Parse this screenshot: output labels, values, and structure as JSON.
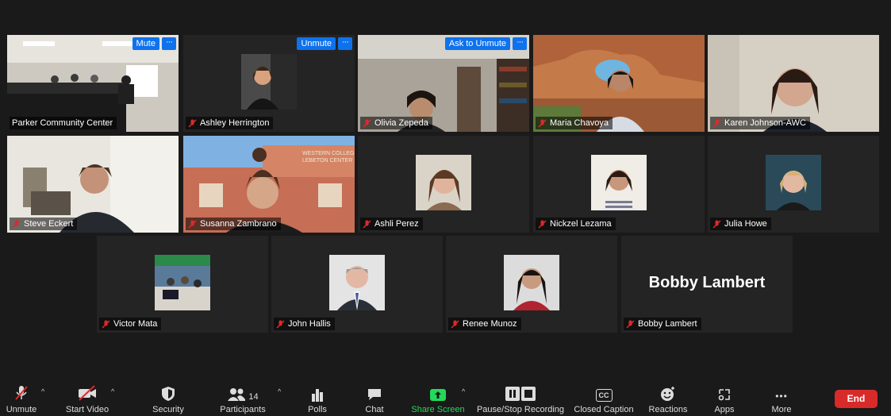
{
  "tiles": [
    {
      "name": "Parker Community Center",
      "control": "Mute"
    },
    {
      "name": "Ashley Herrington",
      "control": "Unmute"
    },
    {
      "name": "Olivia Zepeda",
      "control": "Ask to Unmute"
    },
    {
      "name": "Maria Chavoya"
    },
    {
      "name": "Karen Johnson-AWC"
    },
    {
      "name": "Steve Eckert"
    },
    {
      "name": "Susanna Zambrano",
      "background_text": "WESTERN COLLEGE\nLEBETON CENTER"
    },
    {
      "name": "Ashli Perez"
    },
    {
      "name": "Nickzel Lezama"
    },
    {
      "name": "Julia Howe"
    },
    {
      "name": "Victor Mata"
    },
    {
      "name": "John Hallis"
    },
    {
      "name": "Renee Munoz"
    },
    {
      "name": "Bobby Lambert",
      "display_name": "Bobby Lambert"
    }
  ],
  "more_dots": "···",
  "toolbar": {
    "unmute": "Unmute",
    "start_video": "Start Video",
    "security": "Security",
    "participants": "Participants",
    "participants_count": "14",
    "polls": "Polls",
    "chat": "Chat",
    "share_screen": "Share Screen",
    "pause_recording": "Pause/Stop Recording",
    "closed_caption": "Closed Caption",
    "cc_badge": "CC",
    "reactions": "Reactions",
    "apps": "Apps",
    "more": "More",
    "more_dots": "•••",
    "end": "End"
  },
  "colors": {
    "active_border": "#9fd44a",
    "control_blue": "#0e72ed",
    "share_green": "#23d959",
    "end_red": "#d92a2a",
    "muted_red": "#e02828"
  }
}
